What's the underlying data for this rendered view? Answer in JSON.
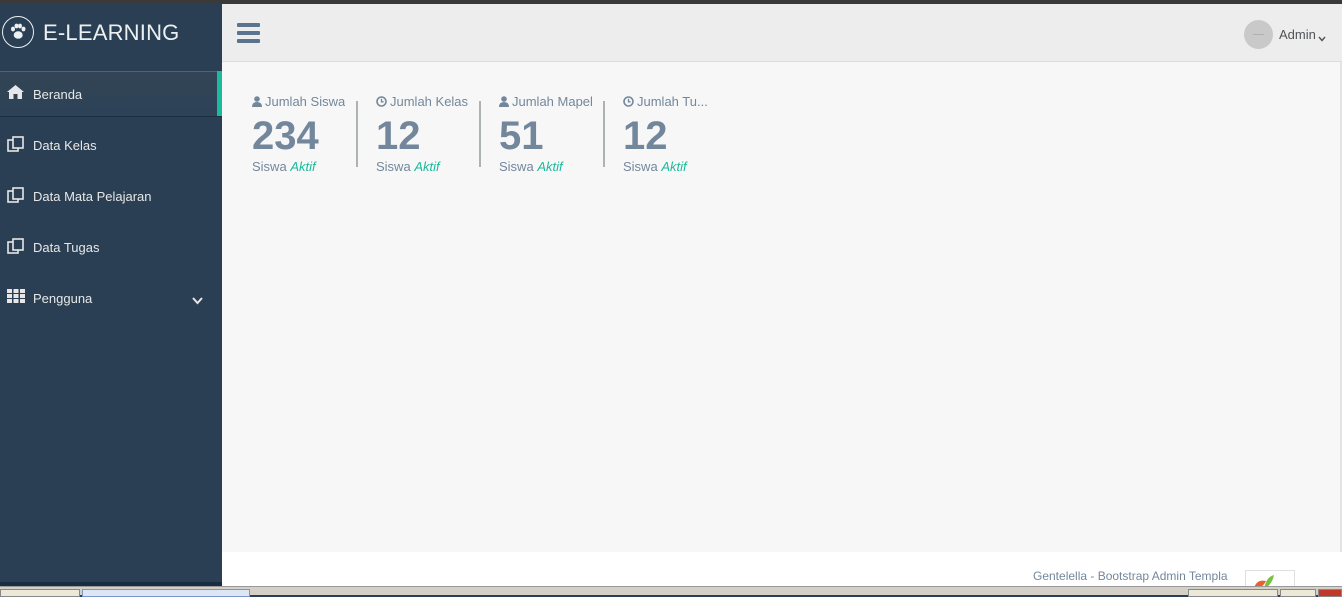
{
  "app": {
    "title": "E-LEARNING",
    "logo_icon": "paw-icon"
  },
  "sidebar": {
    "items": [
      {
        "label": "Beranda",
        "icon": "home-icon",
        "active": true
      },
      {
        "label": "Data Kelas",
        "icon": "clone-icon"
      },
      {
        "label": "Data Mata Pelajaran",
        "icon": "clone-icon"
      },
      {
        "label": "Data Tugas",
        "icon": "clone-icon"
      },
      {
        "label": "Pengguna",
        "icon": "grid-icon",
        "has_submenu": true
      }
    ]
  },
  "topnav": {
    "menu_icon": "hamburger-icon",
    "user_name": "Admin"
  },
  "stats": [
    {
      "title": "Jumlah Siswa",
      "icon": "user-icon",
      "count": "234",
      "foot_prefix": "Siswa",
      "foot_status": "Aktif"
    },
    {
      "title": "Jumlah Kelas",
      "icon": "clock-icon",
      "count": "12",
      "foot_prefix": "Siswa",
      "foot_status": "Aktif"
    },
    {
      "title": "Jumlah Mapel",
      "icon": "user-icon",
      "count": "51",
      "foot_prefix": "Siswa",
      "foot_status": "Aktif"
    },
    {
      "title": "Jumlah Tu...",
      "icon": "clock-icon",
      "count": "12",
      "foot_prefix": "Siswa",
      "foot_status": "Aktif"
    }
  ],
  "footer": {
    "text": "Gentelella - Bootstrap Admin Templa"
  },
  "colors": {
    "sidebar": "#2a3f54",
    "accent": "#1abb9c",
    "text_muted": "#73879c",
    "content_bg": "#f7f7f7"
  }
}
